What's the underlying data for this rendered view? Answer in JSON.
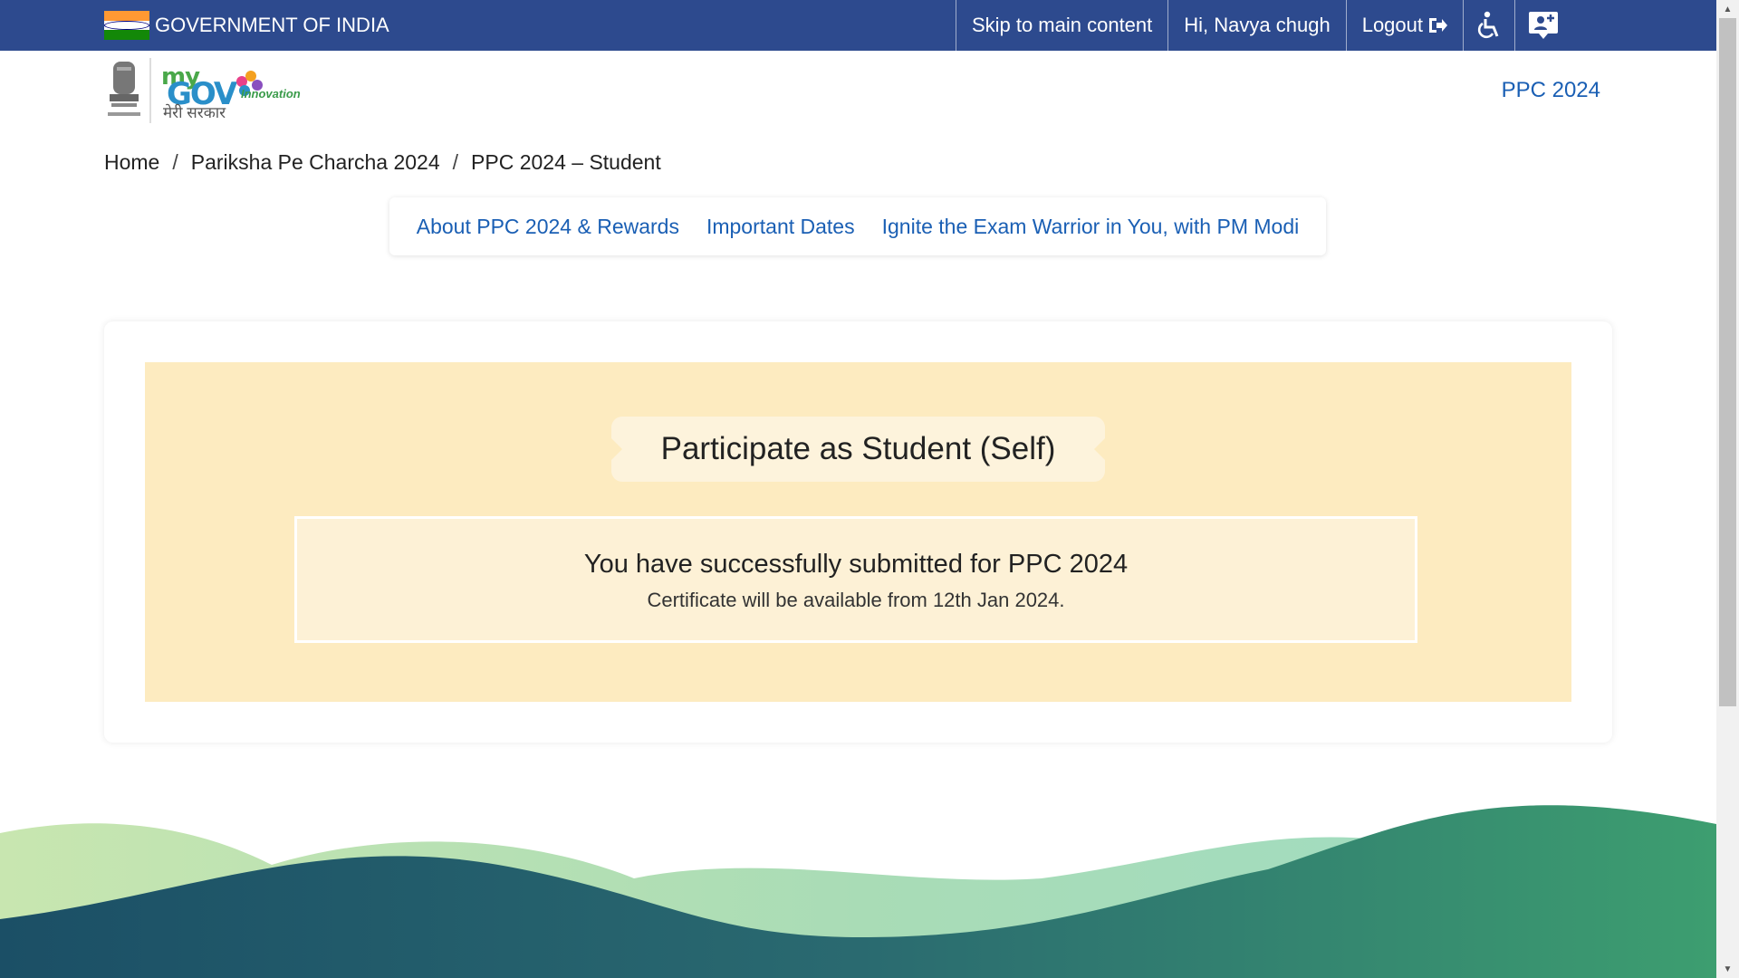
{
  "gov_bar": {
    "title": "GOVERNMENT OF INDIA",
    "skip_link": "Skip to main content",
    "greeting": "Hi, Navya chugh",
    "logout": "Logout",
    "icons": [
      "accessibility-icon",
      "user-add-icon"
    ]
  },
  "header": {
    "logo_my": "my",
    "logo_gov": "GOV",
    "logo_hindi": "मेरी सरकार",
    "logo_innovation": "Innovation",
    "ppc_link": "PPC 2024"
  },
  "breadcrumb": {
    "items": [
      "Home",
      "Pariksha Pe Charcha 2024",
      "PPC 2024 – Student"
    ],
    "separator": "/"
  },
  "subnav": {
    "items": [
      "About PPC 2024 & Rewards",
      "Important Dates",
      "Ignite the Exam Warrior in You, with PM Modi"
    ]
  },
  "main": {
    "heading": "Participate as Student (Self)",
    "message": "You have successfully submitted for PPC 2024",
    "sub_message": "Certificate will be available from 12th Jan 2024."
  },
  "colors": {
    "gov_bar": "#2d4a8e",
    "link": "#1a5fb4",
    "panel": "#fdebc0",
    "wave_dark": "#1f5a6e",
    "wave_green": "#3a9a6a",
    "wave_light": "#a8dcb8"
  }
}
